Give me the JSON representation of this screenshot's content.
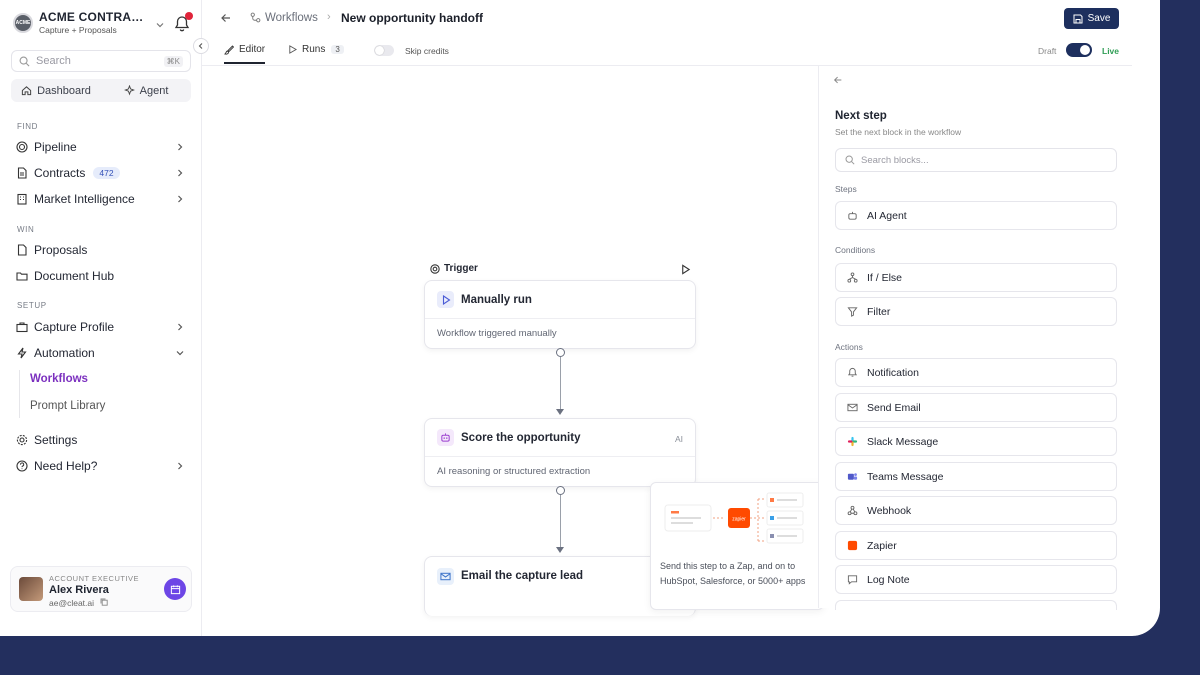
{
  "org": {
    "logo_text": "ACME",
    "name": "ACME CONTRACT...",
    "subtitle": "Capture + Proposals"
  },
  "sidebar": {
    "search_placeholder": "Search",
    "search_shortcut": "⌘K",
    "top_tabs": [
      {
        "label": "Dashboard"
      },
      {
        "label": "Agent"
      }
    ],
    "sections": {
      "find": "FIND",
      "win": "WIN",
      "setup": "SETUP"
    },
    "items": {
      "pipeline": "Pipeline",
      "contracts": "Contracts",
      "contracts_count": "472",
      "market": "Market Intelligence",
      "proposals": "Proposals",
      "document_hub": "Document Hub",
      "capture_profile": "Capture Profile",
      "automation": "Automation",
      "workflows": "Workflows",
      "prompt_library": "Prompt Library",
      "settings": "Settings",
      "help": "Need Help?"
    },
    "account": {
      "role": "ACCOUNT EXECUTIVE",
      "name": "Alex Rivera",
      "email": "ae@cleat.ai"
    }
  },
  "header": {
    "breadcrumb": "Workflows",
    "title": "New opportunity handoff",
    "save_label": "Save"
  },
  "tabs": {
    "editor": "Editor",
    "runs": "Runs",
    "runs_count": "3",
    "skip_credits": "Skip credits",
    "draft": "Draft",
    "live": "Live"
  },
  "canvas": {
    "trigger_label": "Trigger",
    "nodes": [
      {
        "title": "Manually run",
        "desc": "Workflow triggered manually"
      },
      {
        "title": "Score the opportunity",
        "desc": "AI reasoning or structured extraction",
        "tag": "AI"
      },
      {
        "title": "Email the capture lead"
      }
    ],
    "zap_popup": {
      "logo_text": "zapier",
      "desc": "Send this step to a Zap, and on to HubSpot, Salesforce, or 5000+ apps"
    }
  },
  "panel": {
    "title": "Next step",
    "subtitle": "Set the next block in the workflow",
    "search_placeholder": "Search blocks...",
    "sections": {
      "steps": "Steps",
      "conditions": "Conditions",
      "actions": "Actions"
    },
    "steps": [
      "AI Agent"
    ],
    "conditions": [
      "If / Else",
      "Filter"
    ],
    "actions": [
      "Notification",
      "Send Email",
      "Slack Message",
      "Teams Message",
      "Webhook",
      "Zapier",
      "Log Note"
    ]
  },
  "colors": {
    "accent": "#7b2fbf",
    "navy": "#1d2f5e",
    "live": "#2f9e55",
    "zapier": "#ff4a00",
    "background": "#232f5e"
  }
}
